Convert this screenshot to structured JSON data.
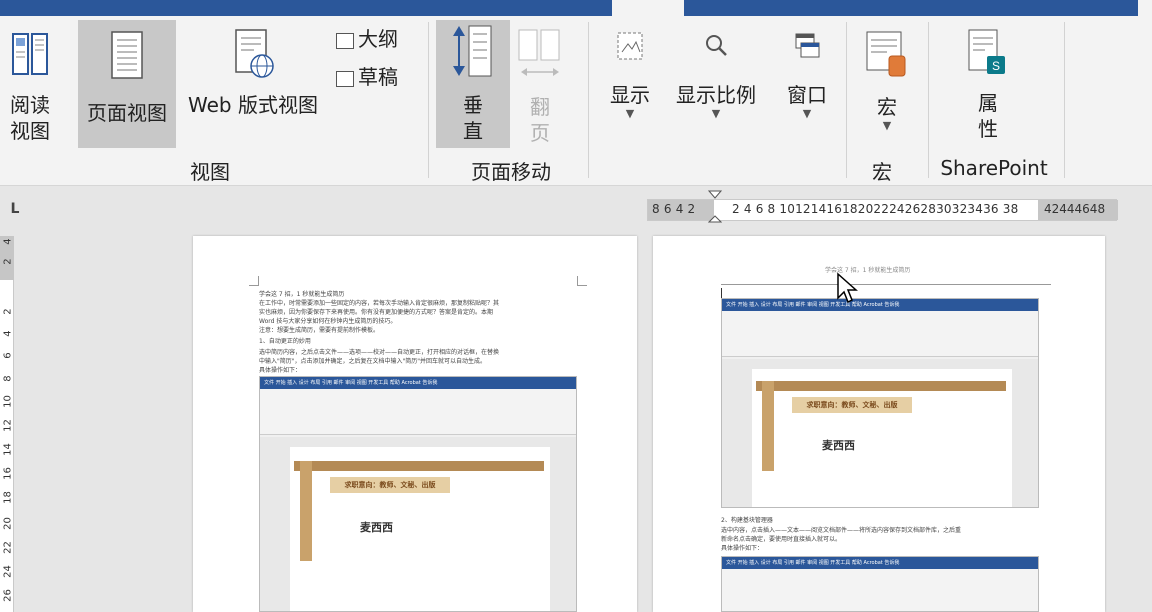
{
  "ribbon": {
    "read_mode": "阅读\n视图",
    "print_layout": "页面视图",
    "web_layout": "Web 版式视图",
    "outline": "大纲",
    "draft": "草稿",
    "vertical": "垂\n直",
    "side_to_side": "翻\n页",
    "show": "显示",
    "zoom": "显示比例",
    "window": "窗口",
    "macros": "宏",
    "properties": "属\n性",
    "groups": {
      "views": "视图",
      "page_movement": "页面移动",
      "macros": "宏",
      "sharepoint": "SharePoint"
    }
  },
  "ruler": {
    "tab_selector": "L",
    "left_numbers": "8 6 4 2",
    "main_numbers": "2  4  6  8 1012141618202224262830323436 38",
    "right_numbers": "42444648",
    "vertical_numbers": [
      "4",
      "2",
      "2",
      "4",
      "6",
      "8",
      "10",
      "12",
      "14",
      "16",
      "18",
      "20",
      "22",
      "24",
      "26"
    ]
  },
  "page1": {
    "title": "学会这 7 招，1 秒就能生成简历",
    "lines": [
      "在工作中，时常需要添加一些固定的内容，若每次手动输入肯定很麻烦，那复制粘贴呢？其",
      "实也麻烦，因为你要保存下来再使用。你有没有更加便捷的方式呢？答案是肯定的。本期",
      "Word 技与大家分享如何在秒钟内生成简历的技巧。",
      "注意：想要生成简历，需要有提前制作模板。",
      "1、自动更正的妙用",
      "选中简历内容，之后点击文件——选项——校对——自动更正，打开相应的对话框，在替换",
      "中输入\"简历\"，点击添加并确定，之后复在文档中输入\"简历\"并回车就可以自动生成。",
      "具体操作如下："
    ],
    "mini": {
      "tabs": "文件   开始   插入   设计   布局   引用   邮件   审阅   视图   开发工具   帮助   Acrobat   告诉我",
      "banner": "求职意向：教师、文秘、出版",
      "name": "麦西西"
    }
  },
  "page2": {
    "header": "学会这 7 招，1 秒就能生成简历",
    "lines": [
      "2、构建基块管理器",
      "选中内容，点击插入——文本——阅览文档部件——将所选内容保存到文档部件库，之后重",
      "新命名点击确定，要使用时直接插入就可以。",
      "具体操作如下："
    ],
    "mini": {
      "tabs": "文件   开始   插入   设计   布局   引用   邮件   审阅   视图   开发工具   帮助   Acrobat   告诉我",
      "banner": "求职意向：教师、文秘、出版",
      "name": "麦西西"
    }
  },
  "colors": {
    "title_bar": "#2b579a",
    "selected": "#c8c8c8",
    "ribbon_bg": "#f3f3f3"
  }
}
